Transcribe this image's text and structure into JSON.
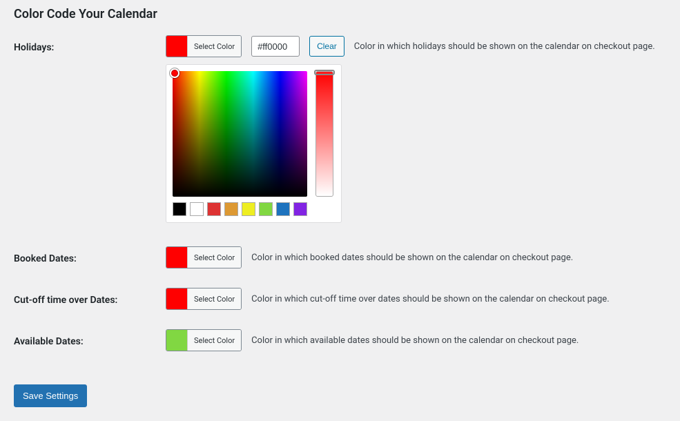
{
  "page_title": "Color Code Your Calendar",
  "select_color_label": "Select Color",
  "clear_label": "Clear",
  "save_button": "Save Settings",
  "rows": {
    "holidays": {
      "label": "Holidays:",
      "hex": "#ff0000",
      "swatch_color": "#ff0000",
      "description": "Color in which holidays should be shown on the calendar on checkout page."
    },
    "booked": {
      "label": "Booked Dates:",
      "swatch_color": "#ff0000",
      "description": "Color in which booked dates should be shown on the calendar on checkout page."
    },
    "cutoff": {
      "label": "Cut-off time over Dates:",
      "swatch_color": "#ff0000",
      "description": "Color in which cut-off time over dates should be shown on the calendar on checkout page."
    },
    "available": {
      "label": "Available Dates:",
      "swatch_color": "#81d742",
      "description": "Color in which available dates should be shown on the calendar on checkout page."
    }
  },
  "palette": [
    "#000000",
    "#ffffff",
    "#dd3333",
    "#dd9933",
    "#eeee22",
    "#81d742",
    "#1e73be",
    "#8224e3"
  ]
}
